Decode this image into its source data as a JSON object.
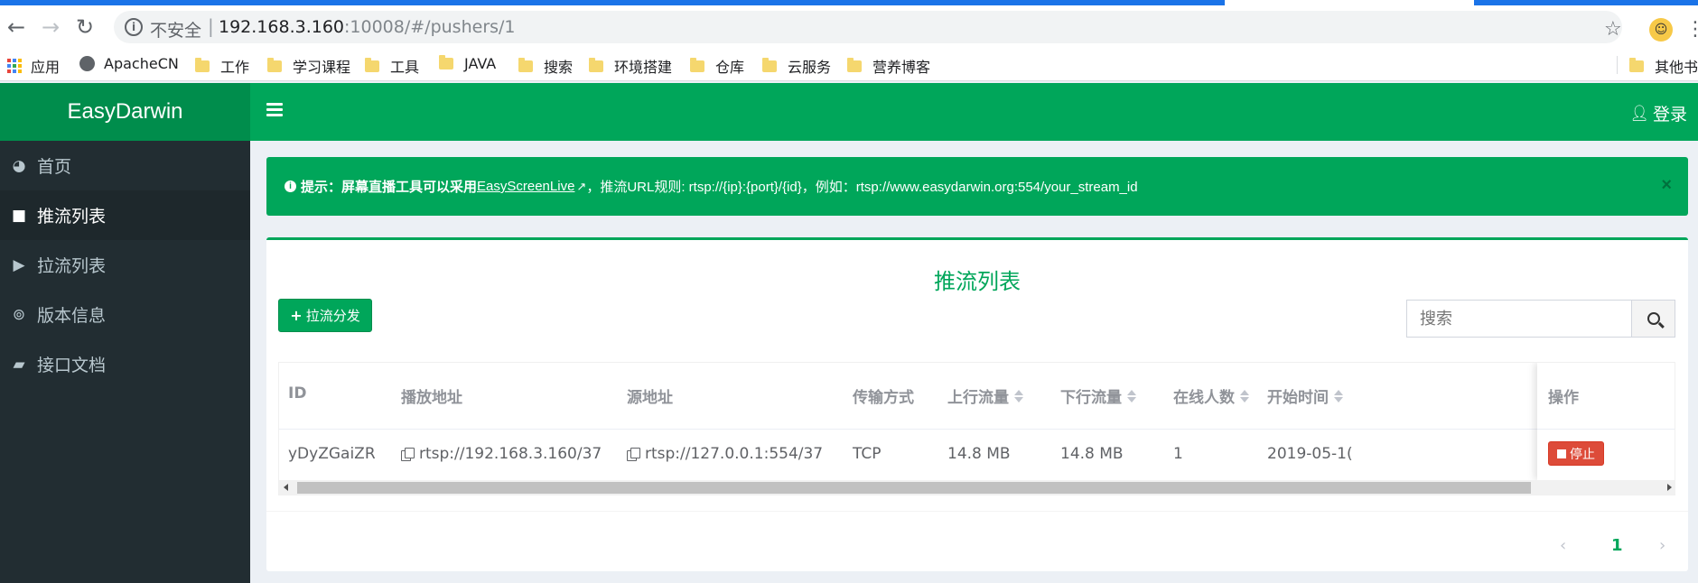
{
  "browser": {
    "security_label": "不安全",
    "url_host": "192.168.3.160",
    "url_rest": ":10008/#/pushers/1"
  },
  "bookmarks": [
    {
      "label": "应用",
      "icon": "apps-icon"
    },
    {
      "label": "ApacheCN",
      "icon": "globe-icon"
    },
    {
      "label": "工作",
      "icon": "folder-icon"
    },
    {
      "label": "学习课程",
      "icon": "folder-icon"
    },
    {
      "label": "工具",
      "icon": "folder-icon"
    },
    {
      "label": "JAVA",
      "icon": "folder-icon"
    },
    {
      "label": "搜索",
      "icon": "folder-icon"
    },
    {
      "label": "环境搭建",
      "icon": "folder-icon"
    },
    {
      "label": "仓库",
      "icon": "folder-icon"
    },
    {
      "label": "云服务",
      "icon": "folder-icon"
    },
    {
      "label": "营养博客",
      "icon": "folder-icon"
    }
  ],
  "other_bookmarks": "其他书签",
  "app": {
    "logo": "EasyDarwin",
    "login_label": "登录"
  },
  "sidebar": {
    "items": [
      {
        "label": "首页",
        "icon": "dashboard-icon"
      },
      {
        "label": "推流列表",
        "icon": "video-camera-icon",
        "active": true
      },
      {
        "label": "拉流列表",
        "icon": "play-icon"
      },
      {
        "label": "版本信息",
        "icon": "life-ring-icon"
      },
      {
        "label": "接口文档",
        "icon": "book-icon"
      }
    ]
  },
  "callout": {
    "prefix": "提示：屏幕直播工具可以采用",
    "link": "EasyScreenLive",
    "rule": "，推流URL规则: rtsp://{ip}:{port}/{id}，例如：rtsp://www.easydarwin.org:554/your_stream_id",
    "close": "×"
  },
  "box": {
    "title": "推流列表",
    "add_button": "拉流分发",
    "search_placeholder": "搜索"
  },
  "table": {
    "headers": {
      "id": "ID",
      "play_url": "播放地址",
      "source_url": "源地址",
      "transport": "传输方式",
      "up_traffic": "上行流量",
      "down_traffic": "下行流量",
      "online": "在线人数",
      "start_time": "开始时间",
      "action": "操作"
    },
    "rows": [
      {
        "id": "yDyZGaiZR",
        "play_url": "rtsp://192.168.3.160/37",
        "source_url": "rtsp://127.0.0.1:554/37",
        "transport": "TCP",
        "up_traffic": "14.8 MB",
        "down_traffic": "14.8 MB",
        "online": "1",
        "start_time": "2019-05-1(",
        "action": "停止"
      }
    ]
  },
  "pagination": {
    "prev": "‹",
    "current": "1",
    "next": "›"
  },
  "colors": {
    "brand_green": "#00a65a",
    "brand_green_dark": "#008d4c",
    "sidebar_bg": "#222d32",
    "danger": "#dd4b39"
  }
}
